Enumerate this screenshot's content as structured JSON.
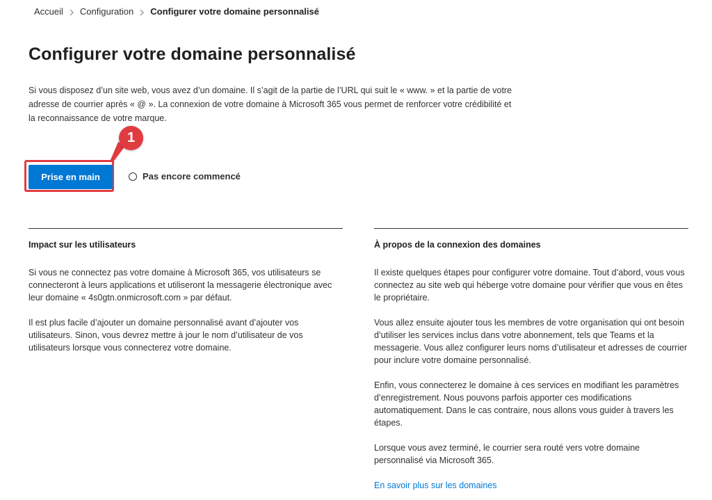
{
  "breadcrumb": {
    "items": [
      "Accueil",
      "Configuration",
      "Configurer votre domaine personnalisé"
    ]
  },
  "page": {
    "title": "Configurer votre domaine personnalisé",
    "intro": "Si vous disposez d’un site web, vous avez d’un domaine. Il s’agit de la partie de l’URL qui suit le « www. » et la partie de votre adresse de courrier après « @ ». La connexion de votre domaine à Microsoft 365 vous permet de renforcer votre crédibilité et la reconnaissance de votre marque."
  },
  "callout": {
    "number": "1",
    "color": "#e13b42"
  },
  "actions": {
    "primary_label": "Prise en main",
    "status_label": "Pas encore commencé"
  },
  "left_column": {
    "heading": "Impact sur les utilisateurs",
    "paragraphs": [
      "Si vous ne connectez pas votre domaine à Microsoft 365, vos utilisateurs se connecteront à leurs applications et utiliseront la messagerie électronique avec leur domaine « 4s0gtn.onmicrosoft.com » par défaut.",
      "Il est plus facile d’ajouter un domaine personnalisé avant d’ajouter vos utilisateurs. Sinon, vous devrez mettre à jour le nom d’utilisateur de vos utilisateurs lorsque vous connecterez votre domaine."
    ]
  },
  "right_column": {
    "heading": "À propos de la connexion des domaines",
    "paragraphs": [
      "Il existe quelques étapes pour configurer votre domaine. Tout d’abord, vous vous connectez au site web qui héberge votre domaine pour vérifier que vous en êtes le propriétaire.",
      "Vous allez ensuite ajouter tous les membres de votre organisation qui ont besoin d’utiliser les services inclus dans votre abonnement, tels que Teams et la messagerie. Vous allez configurer leurs noms d’utilisateur et adresses de courrier pour inclure votre domaine personnalisé.",
      "Enfin, vous connecterez le domaine à ces services en modifiant les paramètres d’enregistrement. Nous pouvons parfois apporter ces modifications automatiquement. Dans le cas contraire, nous allons vous guider à travers les étapes.",
      "Lorsque vous avez terminé, le courrier sera routé vers votre domaine personnalisé via Microsoft 365."
    ],
    "link_label": "En savoir plus sur les domaines"
  },
  "colors": {
    "accent": "#0078d4",
    "highlight": "#e13b42",
    "text": "#323130"
  }
}
